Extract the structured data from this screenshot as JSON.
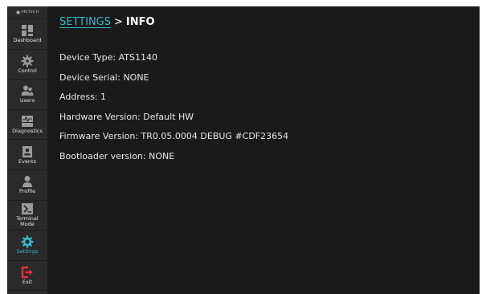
{
  "brand": {
    "logo_text": "ARITECH"
  },
  "sidebar": {
    "items": [
      {
        "label": "Dashboard",
        "icon": "dashboard-icon"
      },
      {
        "label": "Control",
        "icon": "gear-icon"
      },
      {
        "label": "Users",
        "icon": "users-icon"
      },
      {
        "label": "Diagnostics",
        "icon": "diagnostics-icon"
      },
      {
        "label": "Events",
        "icon": "events-icon"
      },
      {
        "label": "Profile",
        "icon": "profile-icon"
      },
      {
        "label_line1": "Terminal",
        "label_line2": "Mode",
        "icon": "terminal-icon"
      },
      {
        "label": "Settings",
        "icon": "settings-gear-icon",
        "active": true
      },
      {
        "label": "Exit",
        "icon": "exit-icon"
      }
    ]
  },
  "colors": {
    "accent": "#38b8c8",
    "exit": "#e0303a",
    "background": "#1a1a1a",
    "sidebar": "#2a2a2a"
  },
  "breadcrumb": {
    "parent": "SETTINGS",
    "separator": ">",
    "current": "INFO"
  },
  "info": {
    "device_type": "Device Type: ATS1140",
    "device_serial": "Device Serial: NONE",
    "address": "Address: 1",
    "hardware_version": "Hardware Version: Default HW",
    "firmware_version": "Firmware Version: TR0.05.0004 DEBUG #CDF23654",
    "bootloader_version": "Bootloader version: NONE"
  }
}
